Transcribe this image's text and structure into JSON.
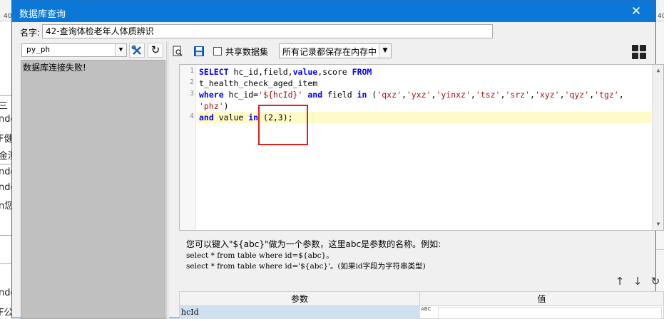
{
  "background": {
    "ruler_marks": [
      "40",
      "40",
      "40"
    ],
    "left_snippets": [
      "三（",
      "nde",
      "F健",
      "金测",
      "nde",
      "nde",
      "n您",
      "nde",
      "F公"
    ]
  },
  "dialog": {
    "title": "数据库查询",
    "close_glyph": "✕",
    "name_label": "名字:",
    "name_value": "42-查询体检老年人体质辨识"
  },
  "left_panel": {
    "datasource_value": "py_ph",
    "message": "数据库连接失败!"
  },
  "toolbar": {
    "share_label": "共享数据集",
    "share_checked": false,
    "save_mode_value": "所有记录都保存在内存中"
  },
  "editor": {
    "line_numbers": [
      "1",
      "2",
      "3",
      "",
      "4"
    ],
    "line1": {
      "k1": "SELECT",
      "t1": " hc_id,field,",
      "k2": "value",
      "t2": ",score ",
      "k3": "FROM"
    },
    "line2": {
      "t1": "t_health_check_aged_item"
    },
    "line3": {
      "k1": "where",
      "t1": " hc_id=",
      "s1": "'${hcId}'",
      "t2": " ",
      "k2": "and",
      "t3": " field ",
      "k3": "in",
      "t4": " (",
      "s2": "'qxz'",
      "t5": ",",
      "s3": "'yxz'",
      "t6": ",",
      "s4": "'yinxz'",
      "t7": ",",
      "s5": "'tsz'",
      "t8": ",",
      "s6": "'srz'",
      "t9": ",",
      "s7": "'xyz'",
      "t10": ",",
      "s8": "'qyz'",
      "t11": ",",
      "s9": "'tgz'",
      "t12": ","
    },
    "line3b": {
      "s1": "'phz'",
      "t1": ")"
    },
    "line4": {
      "k1": "and",
      "t1": " value ",
      "k2": "in",
      "t2": " (2,3);"
    }
  },
  "help": {
    "line1": "您可以键入\"${abc}\"做为一个参数，这里abc是参数的名称。例如:",
    "line2": "select * from table where id=${abc}。",
    "line3": "select * from table where id='${abc}'。(如果id字段为字符串类型)"
  },
  "params_table": {
    "col_param": "参数",
    "col_value": "值",
    "rows": [
      {
        "name": "hcId",
        "type_glyph": "ABC",
        "value": ""
      }
    ]
  },
  "colors": {
    "titlebar": "#0b78d7",
    "keyword": "#0000ff",
    "string": "#a31515",
    "highlight_line": "#fffbc8",
    "annotation_box": "#e02020"
  }
}
